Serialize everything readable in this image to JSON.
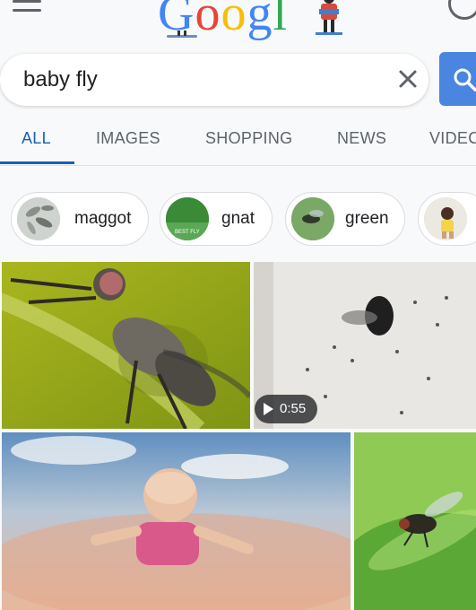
{
  "header": {
    "logo_letters": [
      "G",
      "o",
      "o",
      "g",
      "l"
    ],
    "logo_colors": [
      "#4285f4",
      "#ea4335",
      "#fbbc05",
      "#4285f4",
      "#34a853"
    ]
  },
  "search": {
    "query": "baby fly"
  },
  "tabs": [
    {
      "label": "ALL",
      "active": true
    },
    {
      "label": "IMAGES",
      "active": false
    },
    {
      "label": "SHOPPING",
      "active": false
    },
    {
      "label": "NEWS",
      "active": false
    },
    {
      "label": "VIDEC",
      "active": false
    }
  ],
  "chips": [
    {
      "label": "maggot"
    },
    {
      "label": "gnat",
      "thumb_text": "BEST FLY"
    },
    {
      "label": "green"
    },
    {
      "label": ""
    }
  ],
  "results": [
    {
      "kind": "image",
      "subject": "fly on green stem"
    },
    {
      "kind": "video",
      "subject": "small fly on white surface",
      "duration": "0:55"
    },
    {
      "kind": "image",
      "subject": "baby flying in clouds"
    },
    {
      "kind": "image",
      "subject": "fly on leaf"
    }
  ],
  "colors": {
    "accent": "#1a5fb4",
    "search_button": "#4a86e0"
  }
}
